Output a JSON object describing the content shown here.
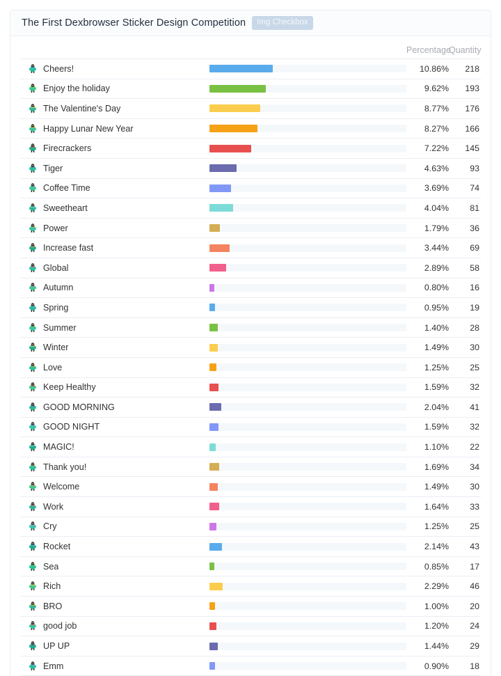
{
  "header": {
    "title": "The First Dexbrowser Sticker Design Competition",
    "badge": "Img Checkbox"
  },
  "table": {
    "columns": {
      "name": "",
      "bar": "",
      "percentage": "Percentage",
      "quantity": "Quantity"
    },
    "bar_scale_max_percent": 12.0,
    "colors": [
      "#5aabec",
      "#7ac143",
      "#fbcd4f",
      "#f5a216",
      "#e8504f",
      "#6a6cae",
      "#8298f7",
      "#7ddcd7",
      "#d4ae55",
      "#f3845f",
      "#f1608c",
      "#cd76e8"
    ],
    "rows": [
      {
        "icon": "sticker-cheers",
        "name": "Cheers!",
        "percentage": "10.86%",
        "pct_value": 10.86,
        "quantity": 218,
        "color": "#5aabec"
      },
      {
        "icon": "sticker-enjoy-the-holiday",
        "name": "Enjoy the holiday",
        "percentage": "9.62%",
        "pct_value": 9.62,
        "quantity": 193,
        "color": "#7ac143"
      },
      {
        "icon": "sticker-valentines-day",
        "name": "The Valentine's Day",
        "percentage": "8.77%",
        "pct_value": 8.77,
        "quantity": 176,
        "color": "#fbcd4f"
      },
      {
        "icon": "sticker-happy-lunar-new-year",
        "name": "Happy Lunar New Year",
        "percentage": "8.27%",
        "pct_value": 8.27,
        "quantity": 166,
        "color": "#f5a216"
      },
      {
        "icon": "sticker-firecrackers",
        "name": "Firecrackers",
        "percentage": "7.22%",
        "pct_value": 7.22,
        "quantity": 145,
        "color": "#e8504f"
      },
      {
        "icon": "sticker-tiger",
        "name": "Tiger",
        "percentage": "4.63%",
        "pct_value": 4.63,
        "quantity": 93,
        "color": "#6a6cae"
      },
      {
        "icon": "sticker-coffee-time",
        "name": "Coffee Time",
        "percentage": "3.69%",
        "pct_value": 3.69,
        "quantity": 74,
        "color": "#8298f7"
      },
      {
        "icon": "sticker-sweetheart",
        "name": "Sweetheart",
        "percentage": "4.04%",
        "pct_value": 4.04,
        "quantity": 81,
        "color": "#7ddcd7"
      },
      {
        "icon": "sticker-power",
        "name": "Power",
        "percentage": "1.79%",
        "pct_value": 1.79,
        "quantity": 36,
        "color": "#d4ae55"
      },
      {
        "icon": "sticker-increase-fast",
        "name": "Increase fast",
        "percentage": "3.44%",
        "pct_value": 3.44,
        "quantity": 69,
        "color": "#f3845f"
      },
      {
        "icon": "sticker-global",
        "name": "Global",
        "percentage": "2.89%",
        "pct_value": 2.89,
        "quantity": 58,
        "color": "#f1608c"
      },
      {
        "icon": "sticker-autumn",
        "name": "Autumn",
        "percentage": "0.80%",
        "pct_value": 0.8,
        "quantity": 16,
        "color": "#cd76e8"
      },
      {
        "icon": "sticker-spring",
        "name": "Spring",
        "percentage": "0.95%",
        "pct_value": 0.95,
        "quantity": 19,
        "color": "#5aabec"
      },
      {
        "icon": "sticker-summer",
        "name": "Summer",
        "percentage": "1.40%",
        "pct_value": 1.4,
        "quantity": 28,
        "color": "#7ac143"
      },
      {
        "icon": "sticker-winter",
        "name": "Winter",
        "percentage": "1.49%",
        "pct_value": 1.49,
        "quantity": 30,
        "color": "#fbcd4f"
      },
      {
        "icon": "sticker-love",
        "name": "Love",
        "percentage": "1.25%",
        "pct_value": 1.25,
        "quantity": 25,
        "color": "#f5a216"
      },
      {
        "icon": "sticker-keep-healthy",
        "name": "Keep Healthy",
        "percentage": "1.59%",
        "pct_value": 1.59,
        "quantity": 32,
        "color": "#e8504f"
      },
      {
        "icon": "sticker-good-morning",
        "name": "GOOD MORNING",
        "percentage": "2.04%",
        "pct_value": 2.04,
        "quantity": 41,
        "color": "#6a6cae"
      },
      {
        "icon": "sticker-good-night",
        "name": "GOOD NIGHT",
        "percentage": "1.59%",
        "pct_value": 1.59,
        "quantity": 32,
        "color": "#8298f7"
      },
      {
        "icon": "sticker-magic",
        "name": "MAGIC!",
        "percentage": "1.10%",
        "pct_value": 1.1,
        "quantity": 22,
        "color": "#7ddcd7"
      },
      {
        "icon": "sticker-thank-you",
        "name": "Thank you!",
        "percentage": "1.69%",
        "pct_value": 1.69,
        "quantity": 34,
        "color": "#d4ae55"
      },
      {
        "icon": "sticker-welcome",
        "name": "Welcome",
        "percentage": "1.49%",
        "pct_value": 1.49,
        "quantity": 30,
        "color": "#f3845f"
      },
      {
        "icon": "sticker-work",
        "name": "Work",
        "percentage": "1.64%",
        "pct_value": 1.64,
        "quantity": 33,
        "color": "#f1608c"
      },
      {
        "icon": "sticker-cry",
        "name": "Cry",
        "percentage": "1.25%",
        "pct_value": 1.25,
        "quantity": 25,
        "color": "#cd76e8"
      },
      {
        "icon": "sticker-rocket",
        "name": "Rocket",
        "percentage": "2.14%",
        "pct_value": 2.14,
        "quantity": 43,
        "color": "#5aabec"
      },
      {
        "icon": "sticker-sea",
        "name": "Sea",
        "percentage": "0.85%",
        "pct_value": 0.85,
        "quantity": 17,
        "color": "#7ac143"
      },
      {
        "icon": "sticker-rich",
        "name": "Rich",
        "percentage": "2.29%",
        "pct_value": 2.29,
        "quantity": 46,
        "color": "#fbcd4f"
      },
      {
        "icon": "sticker-bro",
        "name": "BRO",
        "percentage": "1.00%",
        "pct_value": 1.0,
        "quantity": 20,
        "color": "#f5a216"
      },
      {
        "icon": "sticker-good-job",
        "name": "good job",
        "percentage": "1.20%",
        "pct_value": 1.2,
        "quantity": 24,
        "color": "#e8504f"
      },
      {
        "icon": "sticker-up-up",
        "name": "UP UP",
        "percentage": "1.44%",
        "pct_value": 1.44,
        "quantity": 29,
        "color": "#6a6cae"
      },
      {
        "icon": "sticker-emm",
        "name": "Emm",
        "percentage": "0.90%",
        "pct_value": 0.9,
        "quantity": 18,
        "color": "#8298f7"
      }
    ]
  },
  "chart_data": {
    "type": "bar",
    "title": "The First Dexbrowser Sticker Design Competition",
    "xlabel": "Percentage",
    "ylabel": "",
    "orientation": "horizontal",
    "categories": [
      "Cheers!",
      "Enjoy the holiday",
      "The Valentine's Day",
      "Happy Lunar New Year",
      "Firecrackers",
      "Tiger",
      "Coffee Time",
      "Sweetheart",
      "Power",
      "Increase fast",
      "Global",
      "Autumn",
      "Spring",
      "Summer",
      "Winter",
      "Love",
      "Keep Healthy",
      "GOOD MORNING",
      "GOOD NIGHT",
      "MAGIC!",
      "Thank you!",
      "Welcome",
      "Work",
      "Cry",
      "Rocket",
      "Sea",
      "Rich",
      "BRO",
      "good job",
      "UP UP",
      "Emm"
    ],
    "values": [
      10.86,
      9.62,
      8.77,
      8.27,
      7.22,
      4.63,
      3.69,
      4.04,
      1.79,
      3.44,
      2.89,
      0.8,
      0.95,
      1.4,
      1.49,
      1.25,
      1.59,
      2.04,
      1.59,
      1.1,
      1.69,
      1.49,
      1.64,
      1.25,
      2.14,
      0.85,
      2.29,
      1.0,
      1.2,
      1.44,
      0.9
    ],
    "counts": [
      218,
      193,
      176,
      166,
      145,
      93,
      74,
      81,
      36,
      69,
      58,
      16,
      19,
      28,
      30,
      25,
      32,
      41,
      32,
      22,
      34,
      30,
      33,
      25,
      43,
      17,
      46,
      20,
      24,
      29,
      18
    ],
    "value_unit": "%",
    "xlim": [
      0,
      12
    ],
    "grid": false,
    "legend": false
  }
}
